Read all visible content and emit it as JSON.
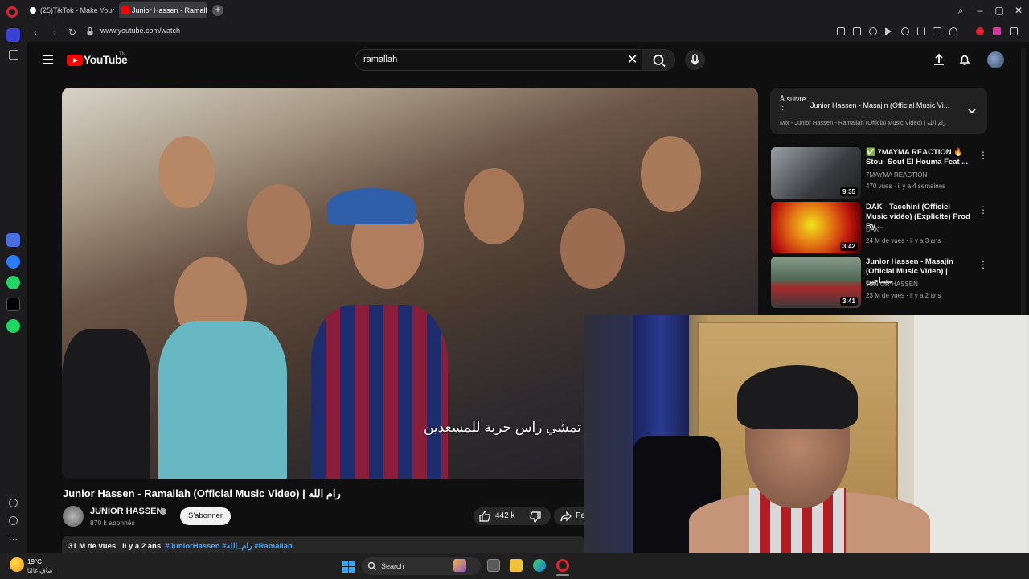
{
  "browser": {
    "tabs": [
      {
        "label": "(25)TikTok - Make Your Da"
      },
      {
        "label": "Junior Hassen - Ramallah"
      }
    ],
    "url": "www.youtube.com/watch"
  },
  "youtube": {
    "logo_text": "YouTube",
    "country": "TN",
    "search": {
      "query": "ramallah"
    }
  },
  "video": {
    "subtitle": "تمشي راس حربة للمسعدين",
    "title": "Junior Hassen - Ramallah (Official Music Video) | رام الله",
    "channel": "JUNIOR HASSEN",
    "subscribers": "870 k abonnés",
    "subscribe_label": "S'abonner",
    "likes": "442 k",
    "share_label": "Pa",
    "views": "31 M de vues",
    "age": "il y a 2 ans",
    "hashtags": "#JuniorHassen #رام_الله #Ramallah"
  },
  "up_next": {
    "label": "À suivre ::",
    "title": "Junior Hassen - Masajin (Official Music Vi...",
    "mix": "Mix - Junior Hassen - Ramallah (Official Music Video) | رام الله"
  },
  "recommendations": [
    {
      "title": "✅ 7MAYMA REACTION 🔥 Stou- Sout El Houma Feat ...",
      "channel": "7MAYMA REACTION",
      "meta": "470 vues · il y a 4 semaines",
      "duration": "9:35"
    },
    {
      "title": "DAK - Tacchini (Officiel Music vidéo) (Explicite) Prod By ...",
      "channel": "DAK",
      "meta": "24 M de vues · il y a 3 ans",
      "duration": "3:42"
    },
    {
      "title": "Junior Hassen - Masajin (Official Music Video) | مساجين",
      "channel": "JUNIOR HASSEN",
      "meta": "23 M de vues · il y a 2 ans",
      "duration": "3:41"
    }
  ],
  "taskbar": {
    "temperature": "19°C",
    "weather": "صافٍ غالبًا",
    "search_label": "Search"
  },
  "colors": {
    "yt_red": "#ff0000",
    "opera_red": "#e0232f",
    "background": "#0f0f0f"
  }
}
